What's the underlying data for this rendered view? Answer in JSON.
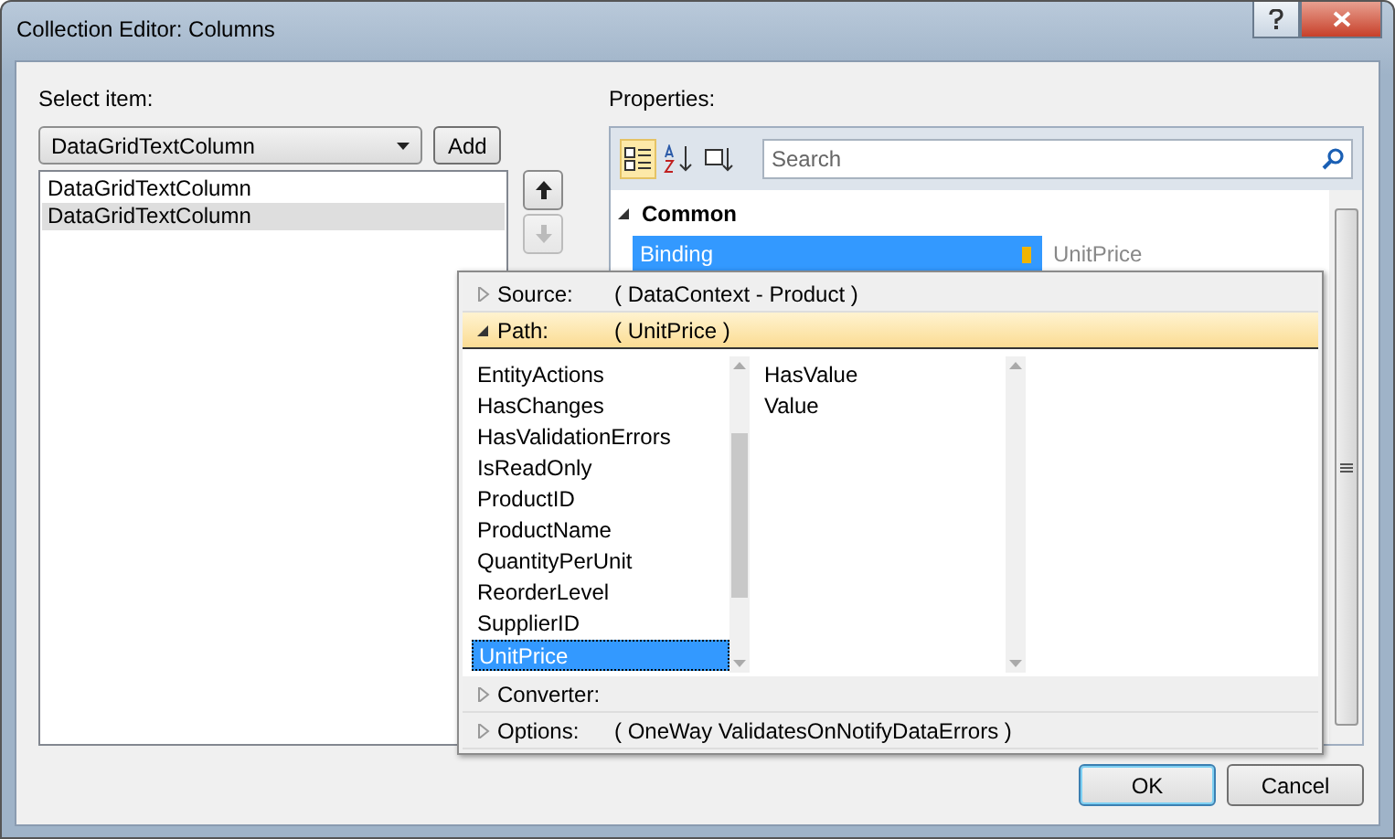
{
  "window": {
    "title": "Collection Editor: Columns"
  },
  "select_item": {
    "label": "Select item:",
    "type_value": "DataGridTextColumn",
    "add_button": "Add",
    "items": [
      {
        "label": "DataGridTextColumn",
        "selected": false
      },
      {
        "label": "DataGridTextColumn",
        "selected": true
      }
    ]
  },
  "properties": {
    "label": "Properties:",
    "view_modes": [
      {
        "selected": true
      },
      {
        "selected": false
      },
      {
        "selected": false
      }
    ],
    "search": {
      "placeholder": "Search"
    },
    "category": {
      "label": "Common",
      "expanded": true
    },
    "binding": {
      "name": "Binding",
      "value": "UnitPrice",
      "selected": true
    }
  },
  "binding_editor": {
    "sections": [
      {
        "label": "Source:",
        "value": "( DataContext - Product )",
        "expanded": false
      },
      {
        "label": "Path:",
        "value": "( UnitPrice )",
        "expanded": true
      },
      {
        "label": "Converter:",
        "expanded": false
      },
      {
        "label": "Options:",
        "value": "( OneWay ValidatesOnNotifyDataErrors )",
        "expanded": false
      }
    ],
    "path_items": [
      {
        "label": "EntityActions",
        "selected": false
      },
      {
        "label": "HasChanges",
        "selected": false
      },
      {
        "label": "HasValidationErrors",
        "selected": false
      },
      {
        "label": "IsReadOnly",
        "selected": false
      },
      {
        "label": "ProductID",
        "selected": false
      },
      {
        "label": "ProductName",
        "selected": false
      },
      {
        "label": "QuantityPerUnit",
        "selected": false
      },
      {
        "label": "ReorderLevel",
        "selected": false
      },
      {
        "label": "SupplierID",
        "selected": false
      },
      {
        "label": "UnitPrice",
        "selected": true
      }
    ],
    "sub_items": [
      {
        "label": "HasValue"
      },
      {
        "label": "Value"
      }
    ]
  },
  "buttons": [
    {
      "label": "OK",
      "kind": "default"
    },
    {
      "label": "Cancel",
      "kind": "normal"
    }
  ]
}
